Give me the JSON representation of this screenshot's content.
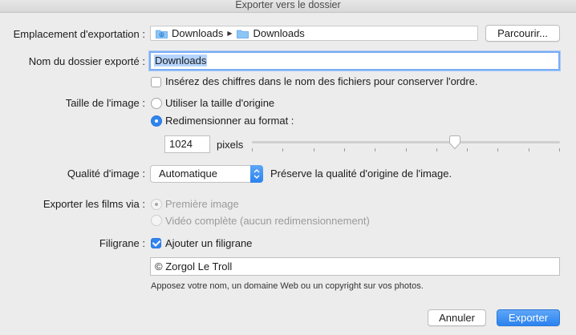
{
  "window": {
    "title": "Exporter vers le dossier"
  },
  "location": {
    "label": "Emplacement d'exportation :",
    "crumbs": [
      "Downloads",
      "Downloads"
    ],
    "browse_label": "Parcourir..."
  },
  "folder_name": {
    "label": "Nom du dossier exporté :",
    "value": "Downloads"
  },
  "numbering": {
    "checked": false,
    "label": "Insérez des chiffres dans le nom des fichiers pour conserver l'ordre."
  },
  "image_size": {
    "label": "Taille de l'image :",
    "options": [
      "Utiliser la taille d'origine",
      "Redimensionner au format :"
    ],
    "selected_index": 1,
    "value": "1024",
    "unit": "pixels",
    "slider_fraction": 0.66
  },
  "quality": {
    "label": "Qualité d'image :",
    "selected": "Automatique",
    "description": "Préserve la qualité d'origine de l'image."
  },
  "movies": {
    "label": "Exporter les films via :",
    "options": [
      "Première image",
      "Vidéo complète (aucun redimensionnement)"
    ],
    "selected_index": 0,
    "enabled": false
  },
  "watermark": {
    "label": "Filigrane :",
    "checkbox_label": "Ajouter un filigrane",
    "checked": true,
    "value": "© Zorgol Le Troll",
    "hint": "Apposez votre nom, un domaine Web ou un copyright sur vos photos."
  },
  "actions": {
    "cancel": "Annuler",
    "export": "Exporter"
  },
  "colors": {
    "accent": "#2f84ef",
    "background": "#ececec"
  }
}
